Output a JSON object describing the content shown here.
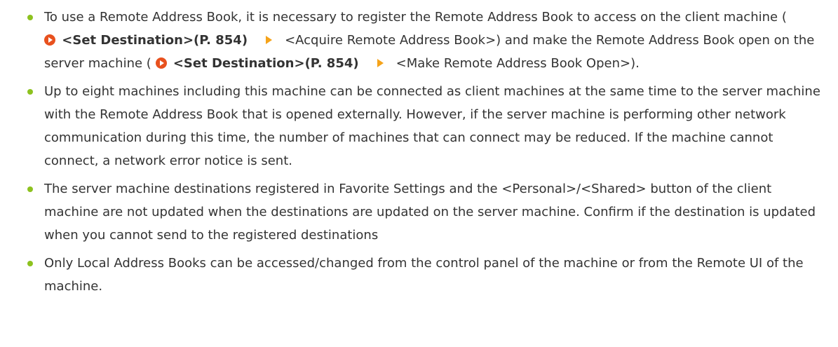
{
  "notes": [
    {
      "text_before_link1": "To use a Remote Address Book, it is necessary to register the Remote Address Book to access on the client machine ( ",
      "link1": "<Set Destination>(P. 854)",
      "text_after_link1": "<Acquire Remote Address Book>) and make the Remote Address Book open on the server machine ( ",
      "link2": "<Set Destination>(P. 854)",
      "text_after_link2": "<Make Remote Address Book Open>)."
    },
    {
      "text": "Up to eight machines including this machine can be connected as client machines at the same time to the server machine with the Remote Address Book that is opened externally. However, if the server machine is performing other network communication during this time, the number of machines that can connect may be reduced. If the machine cannot connect, a network error notice is sent."
    },
    {
      "text": "The server machine destinations registered in Favorite Settings and the <Personal>/<Shared> button of the client machine are not updated when the destinations are updated on the server machine. Confirm if the destination is updated when you cannot send to the registered destinations"
    },
    {
      "text": "Only Local Address Books can be accessed/changed from the control panel of the machine or from the Remote UI of the machine."
    }
  ],
  "icons": {
    "bullet": "bullet-dot-icon",
    "link": "link-arrow-circle-icon",
    "path": "path-arrow-icon"
  },
  "colors": {
    "bullet": "#8dc21f",
    "link_icon": "#e8511e",
    "path_arrow": "#f5a31a",
    "text": "#333333"
  }
}
